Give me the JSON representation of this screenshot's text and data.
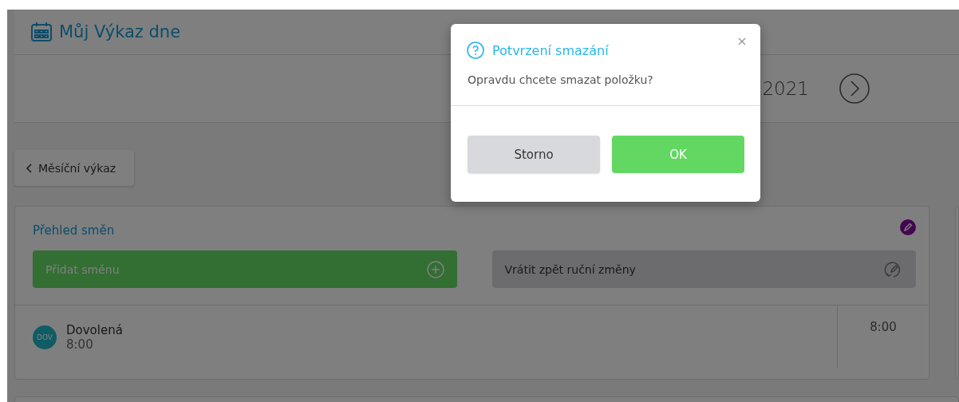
{
  "header": {
    "title": "Můj Výkaz dne"
  },
  "date_bar": {
    "date": "2021"
  },
  "back_button": {
    "label": "Měsíční výkaz"
  },
  "shifts_panel": {
    "title": "Přehled směn",
    "add_button": {
      "label": "Přidat směnu"
    },
    "revert_button": {
      "label": "Vrátit zpět ruční změny"
    },
    "rows": [
      {
        "badge": "DOV",
        "name": "Dovolená",
        "time": "8:00",
        "total": "8:00"
      }
    ]
  },
  "dialog": {
    "title": "Potvrzení smazání",
    "message": "Opravdu chcete smazat položku?",
    "buttons": [
      {
        "label": "Storno",
        "kind": "secondary"
      },
      {
        "label": "OK",
        "kind": "primary"
      }
    ]
  }
}
